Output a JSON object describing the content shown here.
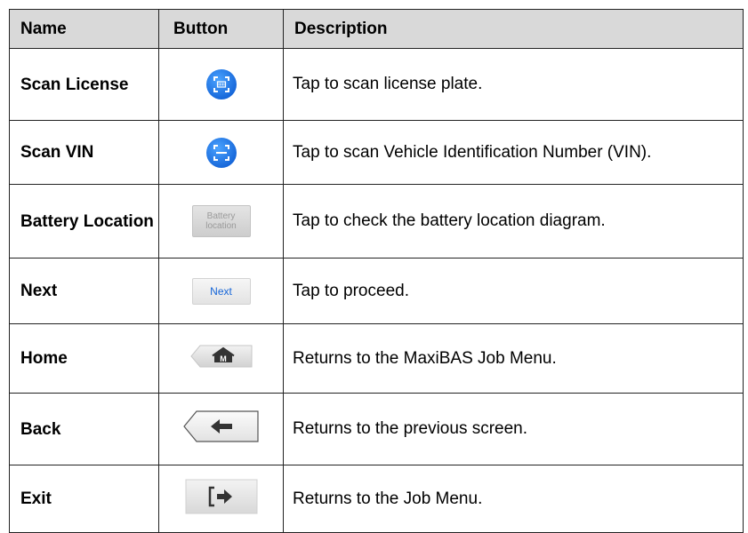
{
  "table": {
    "headers": {
      "name": "Name",
      "button": "Button",
      "description": "Description"
    },
    "rows": [
      {
        "name": "Scan License",
        "icon": "scan-license-icon",
        "description": "Tap to scan license plate."
      },
      {
        "name": "Scan VIN",
        "icon": "scan-vin-icon",
        "description": "Tap to scan Vehicle Identification Number (VIN)."
      },
      {
        "name": "Battery Location",
        "icon": "battery-location-button",
        "button_text": "Battery location",
        "description": "Tap to check the battery location diagram."
      },
      {
        "name": "Next",
        "icon": "next-button",
        "button_text": "Next",
        "description": "Tap to proceed."
      },
      {
        "name": "Home",
        "icon": "home-icon",
        "button_text": "M",
        "description": "Returns to the MaxiBAS Job Menu."
      },
      {
        "name": "Back",
        "icon": "back-arrow-icon",
        "description": "Returns to the previous screen."
      },
      {
        "name": "Exit",
        "icon": "exit-icon",
        "description": "Returns to the Job Menu."
      }
    ]
  },
  "colors": {
    "header_bg": "#d9d9d9",
    "scan_blue": "#1e74e6",
    "next_text": "#1565d8"
  }
}
